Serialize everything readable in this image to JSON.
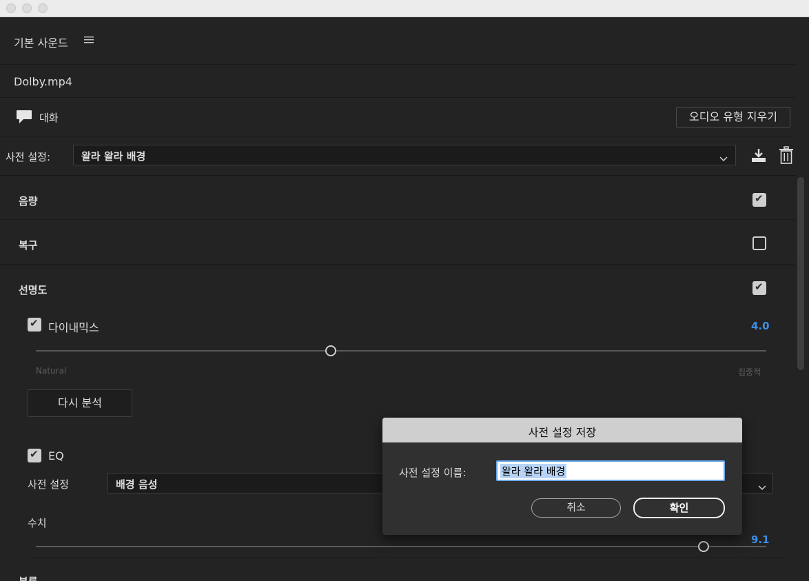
{
  "panel": {
    "title": "기본 사운드",
    "menu_icon": "hamburger-icon",
    "clip_name": "Dolby.mp4",
    "audio_type": "대화",
    "clear_type_button": "오디오 유형 지우기"
  },
  "preset": {
    "label": "사전 설정:",
    "value": "왈라 왈라 배경"
  },
  "sections": {
    "loudness": {
      "label": "음량",
      "checked": true
    },
    "repair": {
      "label": "복구",
      "checked": false
    },
    "clarity": {
      "label": "선명도",
      "checked": true
    }
  },
  "dynamics": {
    "label": "다이내믹스",
    "checked": true,
    "value": "4.0",
    "slider_fraction": 0.4,
    "min_label": "Natural",
    "max_label": "집중적",
    "reanalyze_button": "다시 분석"
  },
  "eq": {
    "label": "EQ",
    "checked": true,
    "preset_label": "사전 설정",
    "preset_value": "배경 음성",
    "amount_label": "수치",
    "amount_value": "9.1",
    "slider_fraction": 0.91
  },
  "next_section_label": "분류",
  "dialog": {
    "title": "사전 설정 저장",
    "name_label": "사전 설정 이름:",
    "name_value": "왈라 왈라 배경",
    "cancel": "취소",
    "ok": "확인"
  }
}
